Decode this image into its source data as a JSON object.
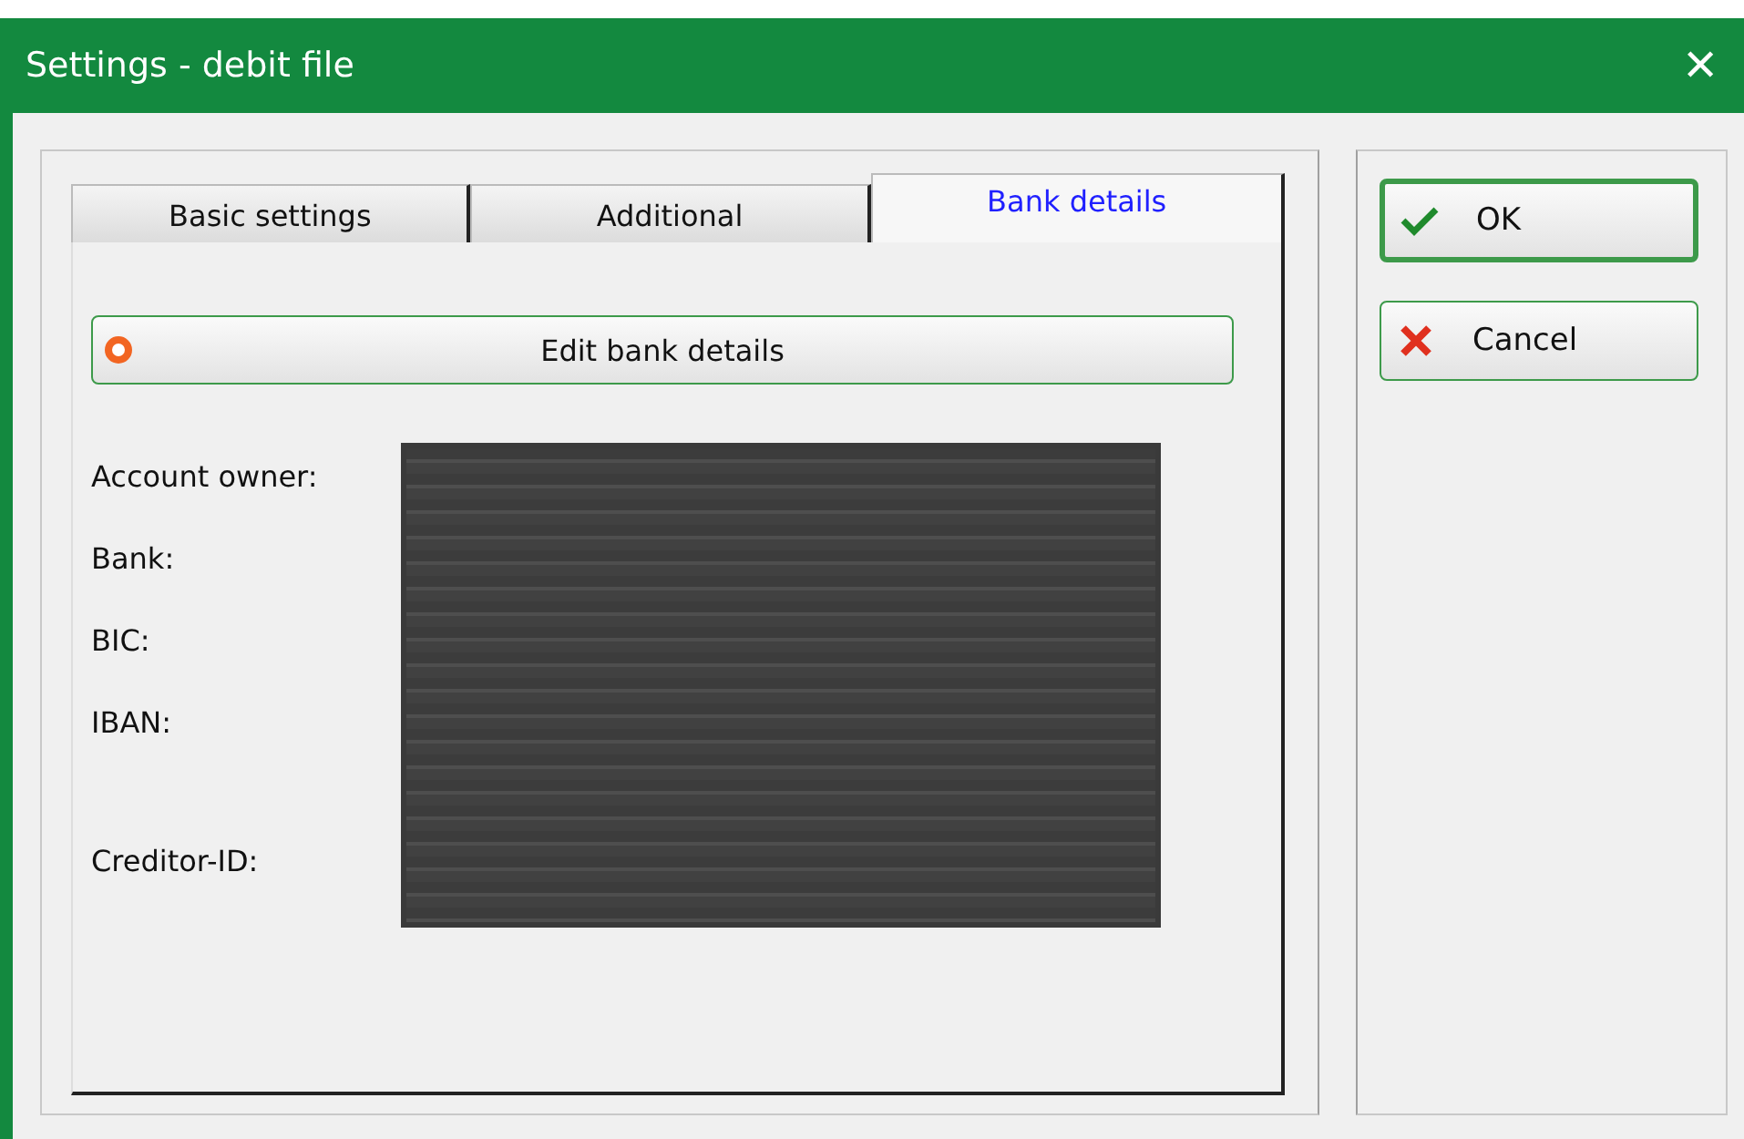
{
  "window": {
    "title": "Settings - debit file",
    "close": "✕"
  },
  "tabs": [
    {
      "label": "Basic settings",
      "selected": false
    },
    {
      "label": "Additional",
      "selected": false
    },
    {
      "label": "Bank details",
      "selected": true
    }
  ],
  "edit_button": {
    "label": "Edit bank details"
  },
  "fields": [
    {
      "label": "Account owner:"
    },
    {
      "label": "Bank:"
    },
    {
      "label": "BIC:"
    },
    {
      "label": "IBAN:"
    },
    {
      "label": "Creditor-ID:"
    }
  ],
  "buttons": [
    {
      "kind": "ok",
      "label": "OK"
    },
    {
      "kind": "cancel",
      "label": "Cancel"
    }
  ]
}
